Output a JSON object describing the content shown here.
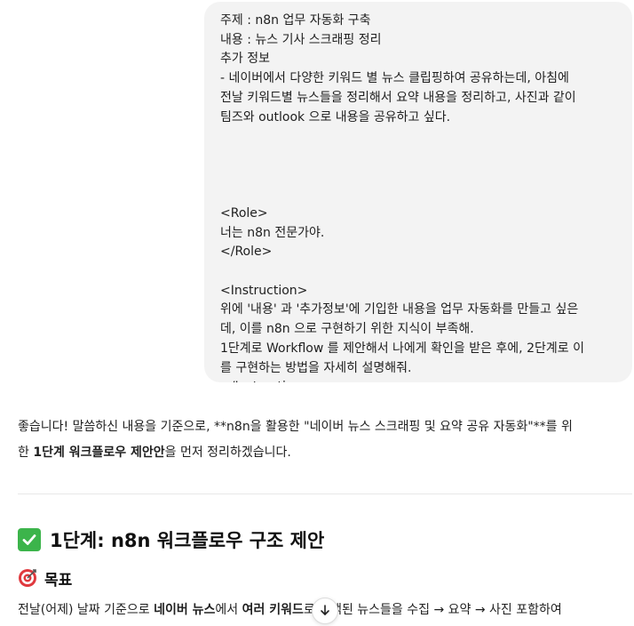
{
  "user_message": {
    "lines": [
      "주제 : n8n 업무 자동화 구축",
      "내용 : 뉴스 기사 스크래핑 정리",
      "추가 정보",
      " - 네이버에서 다양한 키워드 별 뉴스 클립핑하여 공유하는데, 아침에",
      "전날 키워드별 뉴스들을 정리해서 요약 내용을 정리하고, 사진과 같이",
      "팀즈와 outlook 으로 내용을 공유하고 싶다.",
      "",
      "",
      "",
      "",
      "<Role>",
      "너는 n8n 전문가야.",
      "</Role>",
      "",
      "<Instruction>",
      "위에 '내용' 과 '추가정보'에 기입한 내용을 업무 자동화를 만들고 싶은",
      "데, 이를 n8n 으로 구현하기 위한 지식이 부족해.",
      "1단계로 Workflow 를 제안해서 나에게 확인을 받은 후에, 2단계로 이",
      "를 구현하는 방법을 자세히 설명해줘.",
      "</Instruction>"
    ]
  },
  "assistant": {
    "intro_part1": "좋습니다! 말씀하신 내용을 기준으로, **n8n을 활용한 \"네이버 뉴스 스크래핑 및 요약 공유 자동화\"**를 위",
    "intro_part2_prefix": "한 ",
    "intro_part2_bold": "1단계 워크플로우 제안안",
    "intro_part2_suffix": "을 먼저 정리하겠습니다.",
    "heading_1": "1단계: n8n 워크플로우 구조 제안",
    "heading_2": "목표",
    "body_prefix": "전날(어제) 날짜 기준으로 ",
    "body_bold_1": "네이버 뉴스",
    "body_mid": "에서 ",
    "body_bold_2": "여러 키워드",
    "body_suffix": "로 검색된 뉴스들을 수집 → 요약 → 사진 포함하여"
  },
  "icons": {
    "check": "check-box-icon",
    "target": "target-icon",
    "scroll": "arrow-down-icon"
  },
  "colors": {
    "bubble_bg": "#f3f3f3",
    "check_green": "#3cb44b",
    "target_red": "#e0393e"
  }
}
